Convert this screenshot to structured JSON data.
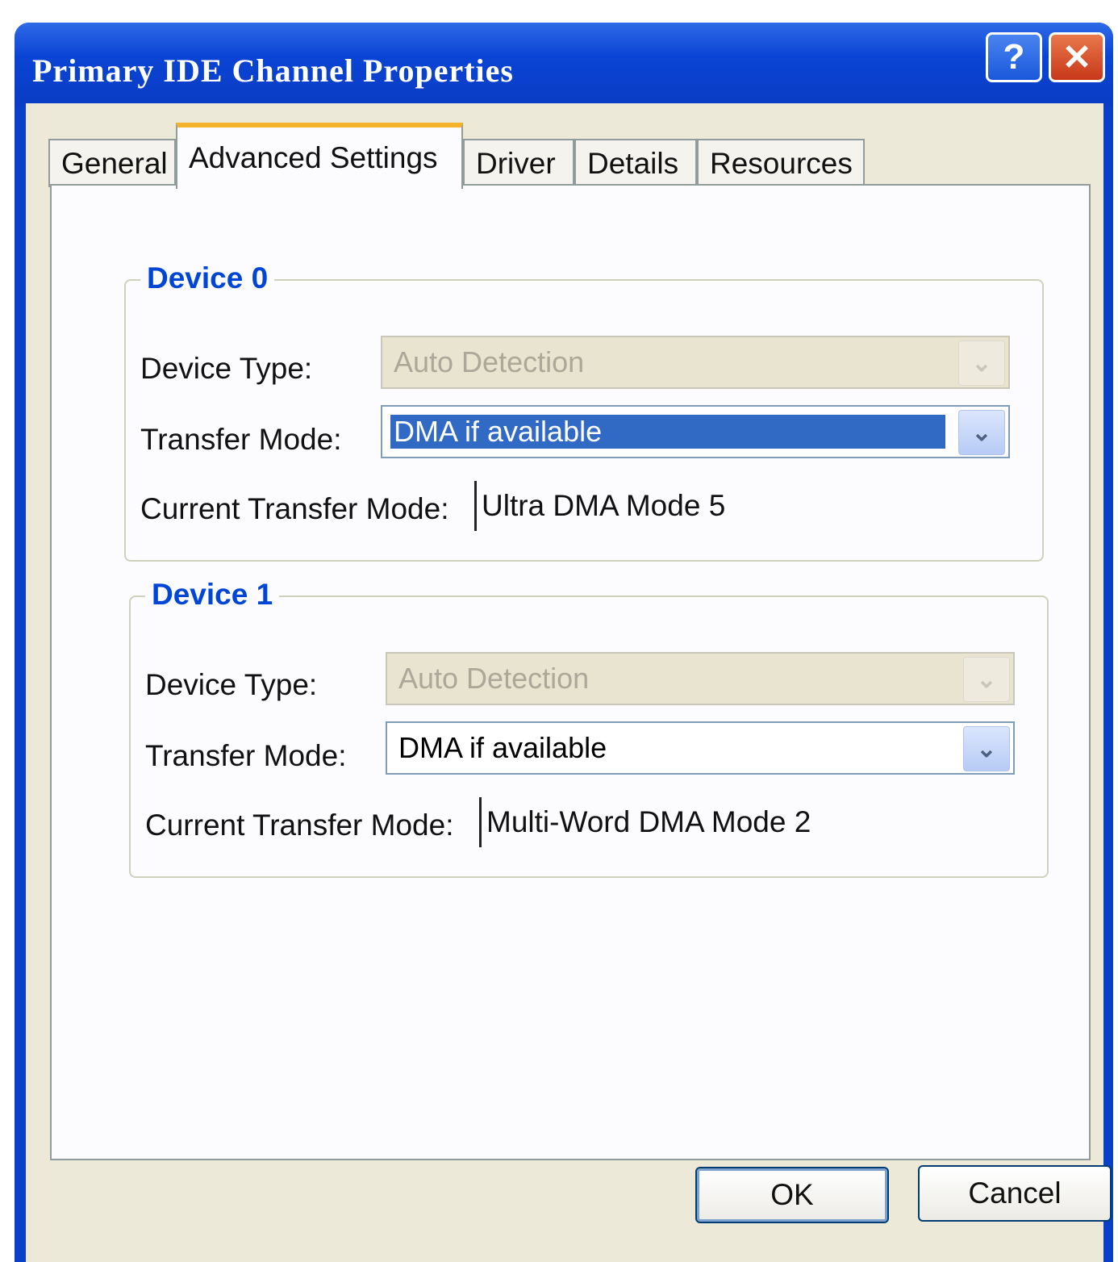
{
  "window": {
    "title": "Primary IDE Channel Properties",
    "help_glyph": "?",
    "close_glyph": "✕"
  },
  "tabs": [
    "General",
    "Advanced Settings",
    "Driver",
    "Details",
    "Resources"
  ],
  "active_tab": "Advanced Settings",
  "device0": {
    "legend": "Device 0",
    "device_type_label": "Device Type:",
    "device_type_value": "Auto Detection",
    "transfer_mode_label": "Transfer Mode:",
    "transfer_mode_value": "DMA if available",
    "current_mode_label": "Current Transfer Mode:",
    "current_mode_value": "Ultra DMA Mode 5"
  },
  "device1": {
    "legend": "Device 1",
    "device_type_label": "Device Type:",
    "device_type_value": "Auto Detection",
    "transfer_mode_label": "Transfer Mode:",
    "transfer_mode_value": "DMA if available",
    "current_mode_label": "Current Transfer Mode:",
    "current_mode_value": "Multi-Word DMA Mode 2"
  },
  "buttons": {
    "ok": "OK",
    "cancel": "Cancel"
  },
  "icons": {
    "dropdown_arrow": "chevron-down-icon"
  },
  "colors": {
    "titlebar": "#0a44d4",
    "accent": "#0046d5",
    "selection": "#316ac5",
    "active_tab_hilite": "#f5b32c"
  }
}
